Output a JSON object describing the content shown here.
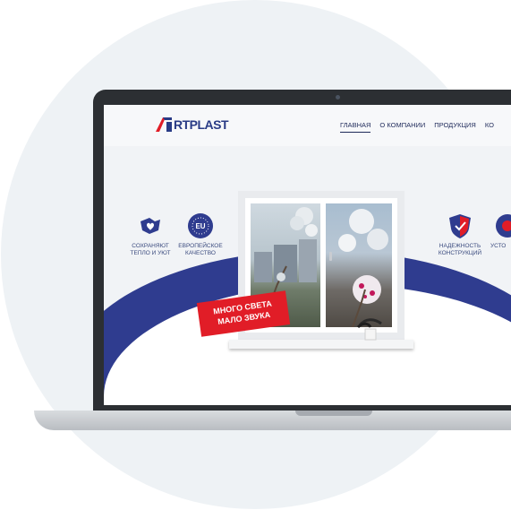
{
  "header": {
    "logo_prefix_letter": "A",
    "logo_text": "RTPLAST",
    "nav": [
      "ГЛАВНАЯ",
      "О КОМПАНИИ",
      "ПРОДУКЦИЯ",
      "КО"
    ]
  },
  "features_left": [
    {
      "icon": "hands-icon",
      "label_line1": "СОХРАНЯЮТ",
      "label_line2": "ТЕПЛО И УЮТ"
    },
    {
      "icon": "eu-icon",
      "icon_text": "EU",
      "label_line1": "ЕВРОПЕЙСКОЕ",
      "label_line2": "КАЧЕСТВО"
    }
  ],
  "features_right": [
    {
      "icon": "shield-icon",
      "label_line1": "НАДЕЖНОСТЬ",
      "label_line2": "КОНСТРУКЦИЙ"
    },
    {
      "icon": "partial-icon",
      "label_line1": "УСТО",
      "label_line2": ""
    }
  ],
  "banner": {
    "line1": "МНОГО СВЕТА",
    "line2": "МАЛО ЗВУКА"
  },
  "colors": {
    "brand_blue": "#2f3c8f",
    "accent_red": "#e11d27",
    "laptop_dark": "#2c2f33"
  }
}
